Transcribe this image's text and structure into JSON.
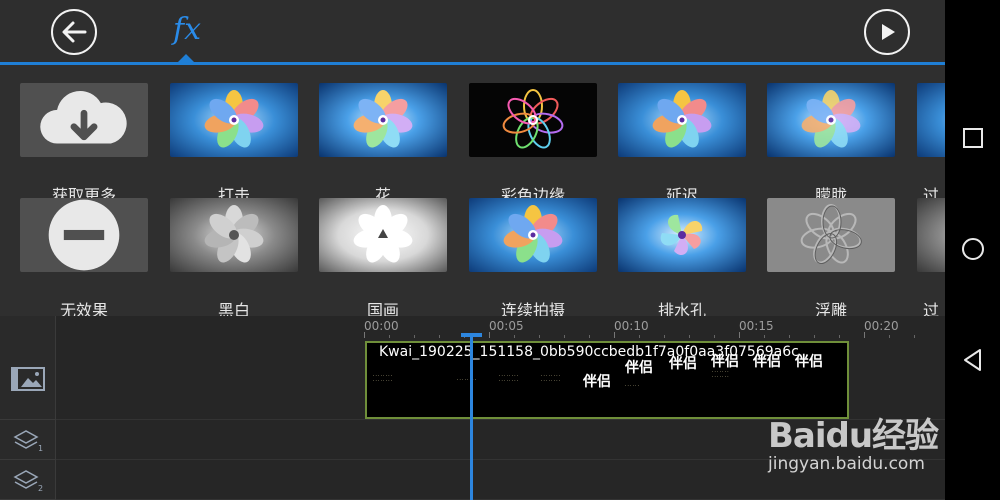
{
  "topbar": {
    "back_icon": "arrow-left-icon",
    "fx_label": "fx",
    "play_icon": "play-icon",
    "accent": "#1f7fd6"
  },
  "effects": {
    "row1": [
      {
        "label": "获取更多",
        "thumb": "cloud-download-icon"
      },
      {
        "label": "打击",
        "thumb": "pinwheel-blue"
      },
      {
        "label": "花",
        "thumb": "pinwheel-blue"
      },
      {
        "label": "彩色边缘",
        "thumb": "pinwheel-neon"
      },
      {
        "label": "延迟",
        "thumb": "pinwheel-blue"
      },
      {
        "label": "朦胧",
        "thumb": "pinwheel-blue"
      },
      {
        "label": "过",
        "thumb": "pinwheel-blue"
      }
    ],
    "row2": [
      {
        "label": "无效果",
        "thumb": "no-entry-icon"
      },
      {
        "label": "黑白",
        "thumb": "pinwheel-gray"
      },
      {
        "label": "国画",
        "thumb": "pinwheel-white"
      },
      {
        "label": "连续拍摄",
        "thumb": "pinwheel-blue"
      },
      {
        "label": "排水孔",
        "thumb": "pinwheel-swirl"
      },
      {
        "label": "浮雕",
        "thumb": "pinwheel-emboss"
      },
      {
        "label": "过",
        "thumb": "pinwheel-gray"
      }
    ]
  },
  "timeline": {
    "ruler": [
      "00:00",
      "00:05",
      "00:10",
      "00:15",
      "00:20"
    ],
    "clip_name": "Kwai_190225_151158_0bb590ccbedb1f7a0f0aa3f07569a6c",
    "clip_text": [
      "伴侣",
      "伴侣",
      "伴侣",
      "伴侣",
      "伴侣",
      "伴侣"
    ],
    "track_icons": [
      "video-track-icon",
      "layer-1-icon",
      "layer-2-icon"
    ],
    "track_numbers": [
      "1",
      "2"
    ]
  },
  "navbar": {
    "items": [
      "recent-apps-icon",
      "home-icon",
      "back-triangle-icon"
    ]
  },
  "watermark": {
    "brand": "Baidu经验",
    "url": "jingyan.baidu.com"
  }
}
